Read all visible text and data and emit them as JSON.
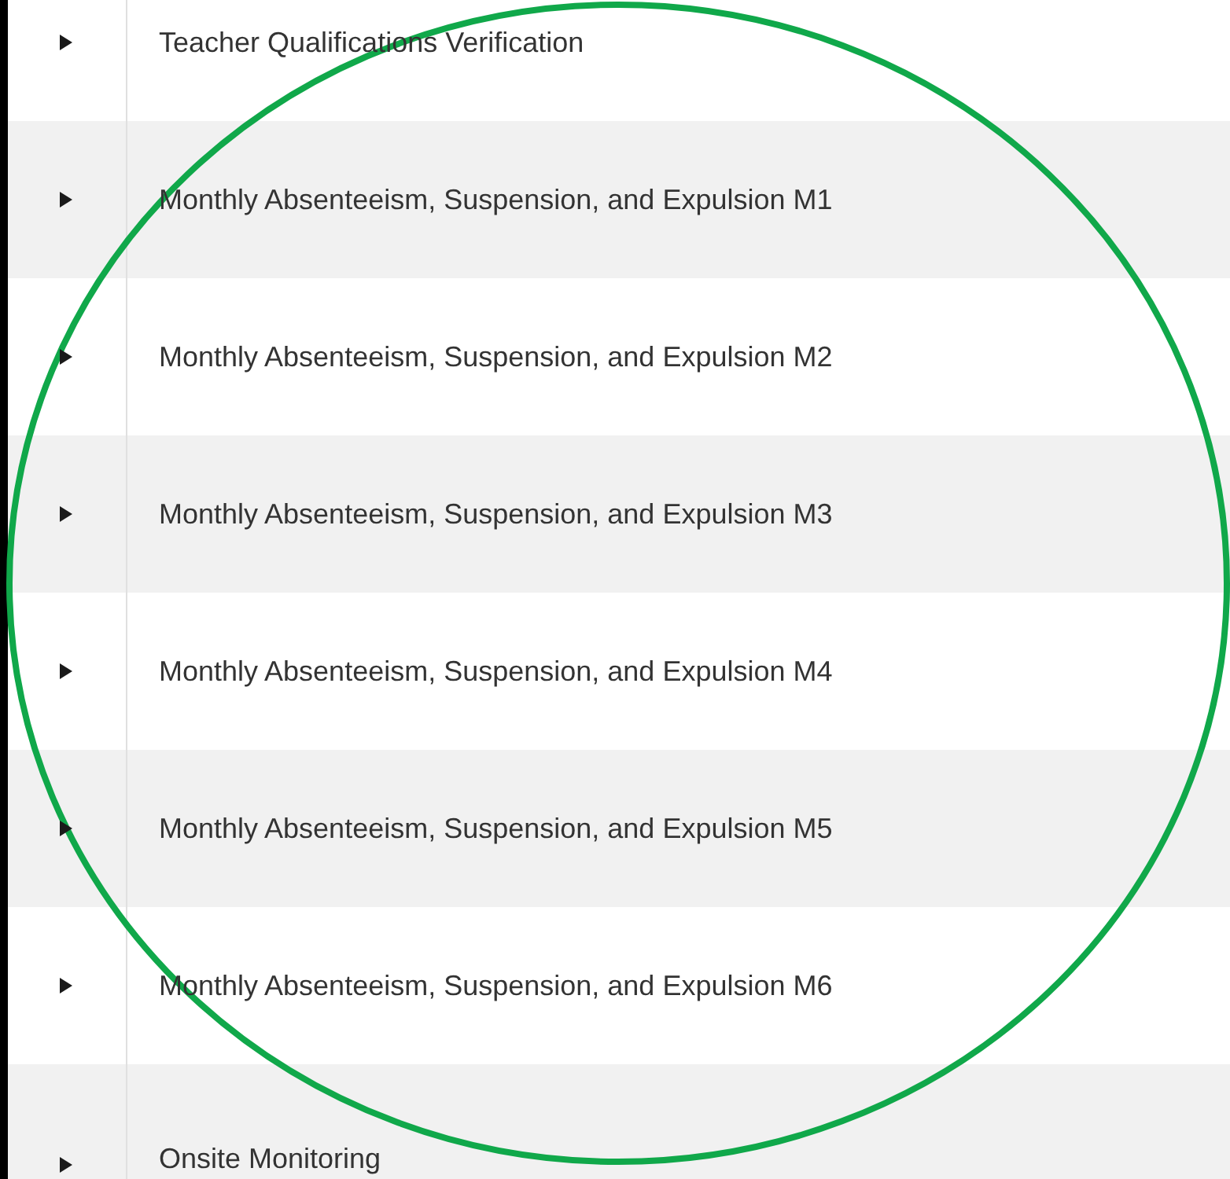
{
  "rows": [
    {
      "label": "Teacher Qualifications Verification",
      "expanded": false
    },
    {
      "label": "Monthly Absenteeism, Suspension, and Expulsion M1",
      "expanded": false
    },
    {
      "label": "Monthly Absenteeism, Suspension, and Expulsion M2",
      "expanded": false
    },
    {
      "label": "Monthly Absenteeism, Suspension, and Expulsion M3",
      "expanded": false
    },
    {
      "label": "Monthly Absenteeism, Suspension, and Expulsion M4",
      "expanded": false
    },
    {
      "label": "Monthly Absenteeism, Suspension, and Expulsion M5",
      "expanded": false
    },
    {
      "label": "Monthly Absenteeism, Suspension, and Expulsion M6",
      "expanded": false
    },
    {
      "label": "Onsite Monitoring",
      "expanded": false
    }
  ],
  "annotation_circle": true
}
